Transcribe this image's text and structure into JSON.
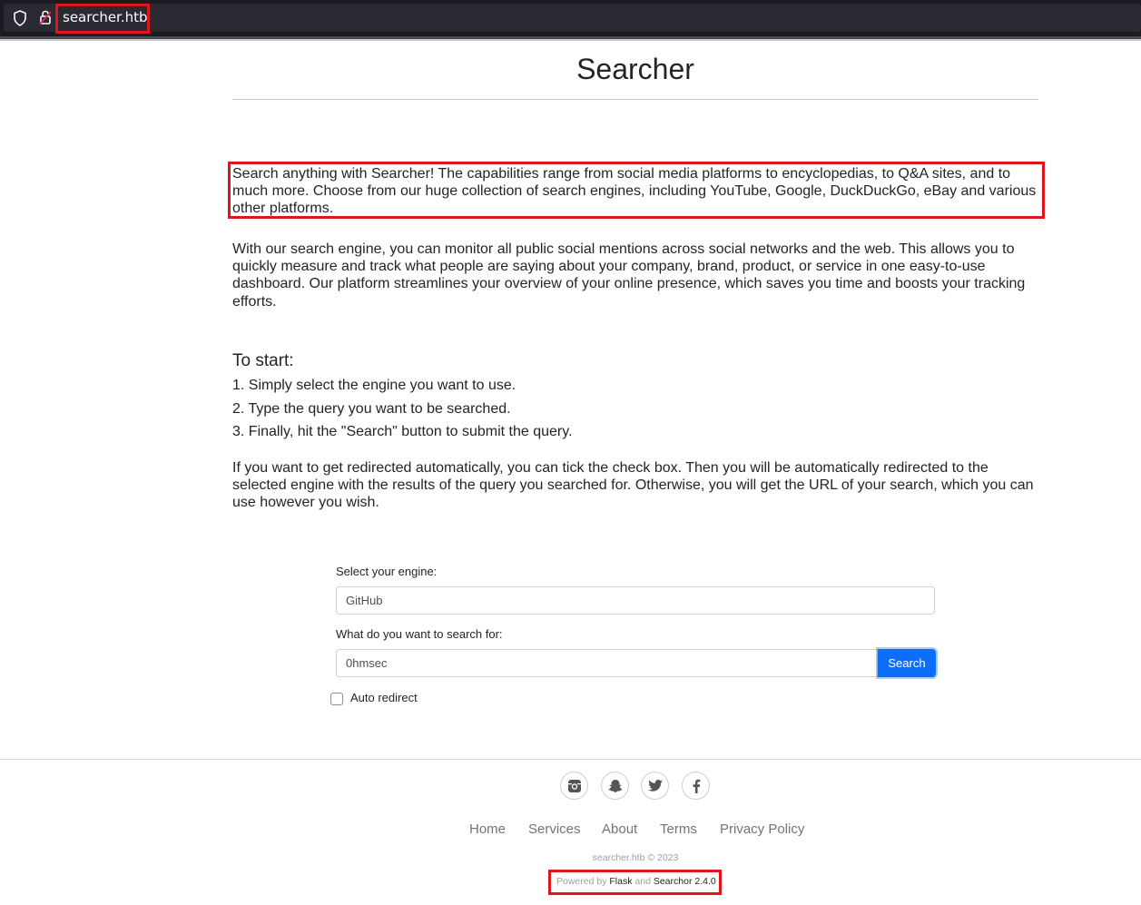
{
  "browser": {
    "url": "searcher.htb"
  },
  "page": {
    "title": "Searcher",
    "intro": "Search anything with Searcher! The capabilities range from social media platforms to encyclopedias, to Q&A sites, and to much more. Choose from our huge collection of search engines, including YouTube, Google, DuckDuckGo, eBay and various other platforms.",
    "monitor": "With our search engine, you can monitor all public social mentions across social networks and the web. This allows you to quickly measure and track what people are saying about your company, brand, product, or service in one easy-to-use dashboard. Our platform streamlines your overview of your online presence, which saves you time and boosts your tracking efforts.",
    "start_heading": "To start:",
    "steps": [
      "1. Simply select the engine you want to use.",
      "2. Type the query you want to be searched.",
      "3. Finally, hit the \"Search\" button to submit the query."
    ],
    "redirect_info": "If you want to get redirected automatically, you can tick the check box. Then you will be automatically redirected to the selected engine with the results of the query you searched for. Otherwise, you will get the URL of your search, which you can use however you wish."
  },
  "form": {
    "engine_label": "Select your engine:",
    "engine_value": "GitHub",
    "query_label": "What do you want to search for:",
    "query_value": "0hmsec",
    "search_button": "Search",
    "auto_redirect_label": "Auto redirect",
    "auto_redirect_checked": false
  },
  "footer": {
    "social_icons": [
      "instagram-icon",
      "snapchat-icon",
      "twitter-icon",
      "facebook-icon"
    ],
    "links": [
      "Home",
      "Services",
      "About",
      "Terms",
      "Privacy Policy"
    ],
    "copyright": "searcher.htb © 2023",
    "powered_prefix": "Powered by",
    "powered_flask": "Flask",
    "powered_and": "and",
    "powered_searchor": "Searchor 2.4.0"
  },
  "colors": {
    "highlight": "#e0161e",
    "primary": "#0d6efd"
  }
}
